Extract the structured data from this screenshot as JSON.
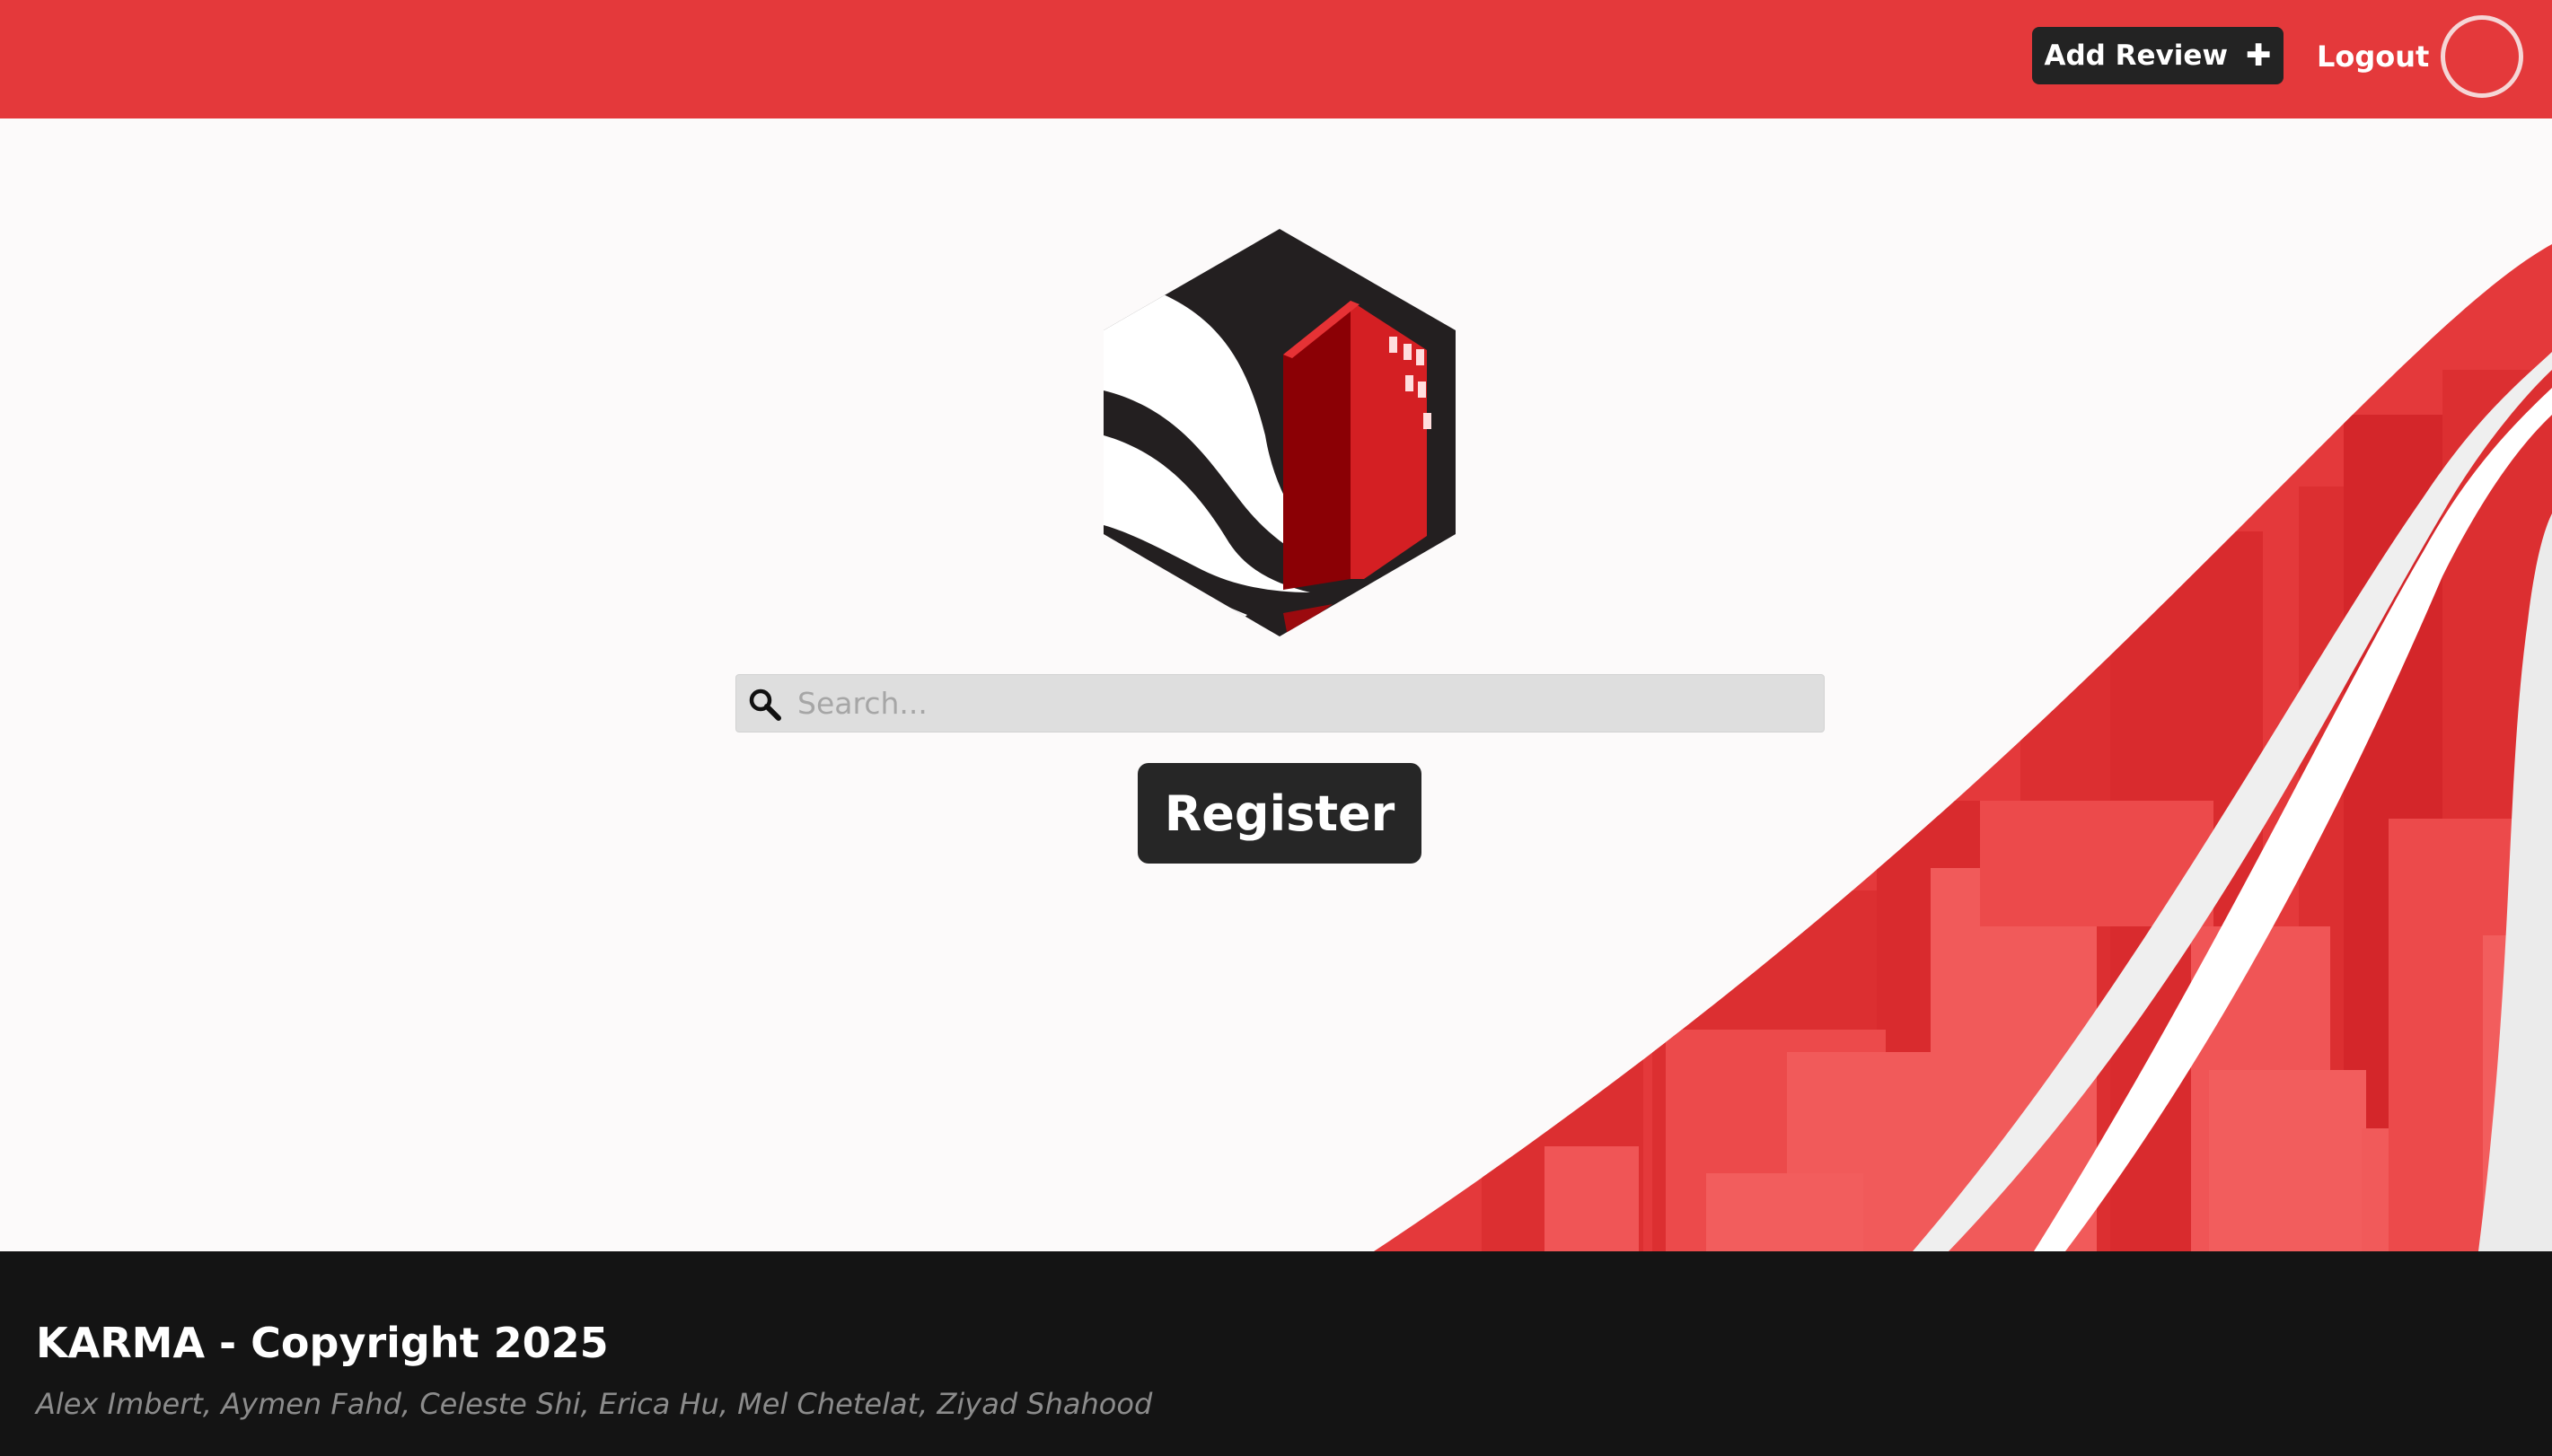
{
  "header": {
    "add_review_label": "Add Review",
    "add_review_icon": "plus-icon",
    "logout_label": "Logout",
    "avatar_icon": "user-avatar-circle"
  },
  "main": {
    "logo_icon": "karma-building-hexagon-logo",
    "search": {
      "icon": "search-icon",
      "placeholder": "Search...",
      "value": ""
    },
    "register_label": "Register"
  },
  "footer": {
    "title": "KARMA - Copyright 2025",
    "credits": "Alex Imbert, Aymen Fahd, Celeste Shi, Erica Hu, Mel Chetelat, Ziyad Shahood"
  },
  "colors": {
    "brand_red": "#e4393b",
    "dark_red": "#8b0005",
    "button_dark": "#262626",
    "footer_bg": "#141414",
    "page_bg": "#fcfafa"
  }
}
